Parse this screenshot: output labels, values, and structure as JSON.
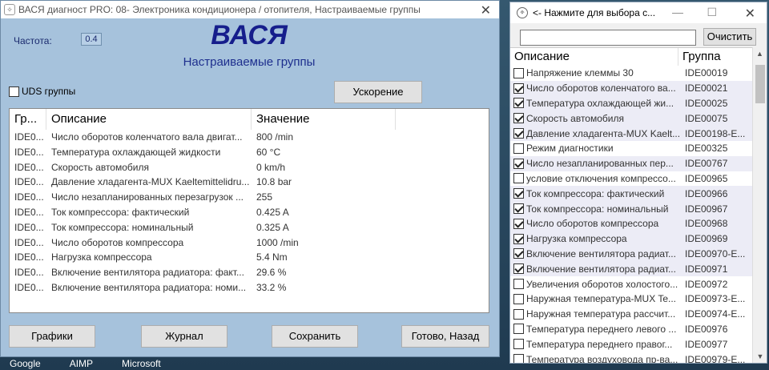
{
  "main_window": {
    "title": "ВАСЯ диагност PRO: 08- Электроника кондиционера / отопителя,  Настраиваемые группы",
    "freq_label": "Частота:",
    "freq_value": "0.4",
    "brand": "ВАСЯ",
    "subtitle": "Настраиваемые группы",
    "uds_label": "UDS группы",
    "accel_button": "Ускорение",
    "columns": [
      "Гр...",
      "Описание",
      "Значение"
    ],
    "rows": [
      {
        "id": "IDE0...",
        "desc": "Число оборотов коленчатого вала двигат...",
        "value": "800 /min"
      },
      {
        "id": "IDE0...",
        "desc": "Температура охлаждающей жидкости",
        "value": "60 °C"
      },
      {
        "id": "IDE0...",
        "desc": "Скорость автомобиля",
        "value": "0 km/h"
      },
      {
        "id": "IDE0...",
        "desc": "Давление хладагента-MUX Kaeltemittelidru...",
        "value": "10.8 bar"
      },
      {
        "id": "IDE0...",
        "desc": "Число незапланированных перезагрузок ...",
        "value": "255"
      },
      {
        "id": "IDE0...",
        "desc": "Ток компрессора: фактический",
        "value": "0.425 A"
      },
      {
        "id": "IDE0...",
        "desc": "Ток компрессора: номинальный",
        "value": "0.325 A"
      },
      {
        "id": "IDE0...",
        "desc": "Число оборотов компрессора",
        "value": "1000 /min"
      },
      {
        "id": "IDE0...",
        "desc": "Нагрузка компрессора",
        "value": "5.4 Nm"
      },
      {
        "id": "IDE0...",
        "desc": "Включение вентилятора радиатора: факт...",
        "value": "29.6 %"
      },
      {
        "id": "IDE0...",
        "desc": "Включение вентилятора радиатора: номи...",
        "value": "33.2 %"
      }
    ],
    "buttons": {
      "graphs": "Графики",
      "journal": "Журнал",
      "save": "Сохранить",
      "done": "Готово, Назад"
    }
  },
  "side_window": {
    "title": "<- Нажмите для выбора с...",
    "clear_button": "Очистить",
    "search_value": "",
    "columns": [
      "Описание",
      "Группа"
    ],
    "items": [
      {
        "desc": "Напряжение клеммы 30",
        "group": "IDE00019",
        "checked": false
      },
      {
        "desc": "Число оборотов коленчатого ва...",
        "group": "IDE00021",
        "checked": true
      },
      {
        "desc": "Температура охлаждающей жи...",
        "group": "IDE00025",
        "checked": true
      },
      {
        "desc": "Скорость автомобиля",
        "group": "IDE00075",
        "checked": true
      },
      {
        "desc": "Давление хладагента-MUX Kaelt...",
        "group": "IDE00198-E...",
        "checked": true
      },
      {
        "desc": "Режим диагностики",
        "group": "IDE00325",
        "checked": false
      },
      {
        "desc": "Число незапланированных пер...",
        "group": "IDE00767",
        "checked": true
      },
      {
        "desc": "условие отключения компрессо...",
        "group": "IDE00965",
        "checked": false
      },
      {
        "desc": "Ток компрессора: фактический",
        "group": "IDE00966",
        "checked": true
      },
      {
        "desc": "Ток компрессора: номинальный",
        "group": "IDE00967",
        "checked": true
      },
      {
        "desc": "Число оборотов компрессора",
        "group": "IDE00968",
        "checked": true
      },
      {
        "desc": "Нагрузка компрессора",
        "group": "IDE00969",
        "checked": true
      },
      {
        "desc": "Включение вентилятора радиат...",
        "group": "IDE00970-E...",
        "checked": true
      },
      {
        "desc": "Включение вентилятора радиат...",
        "group": "IDE00971",
        "checked": true
      },
      {
        "desc": "Увеличения оборотов холостого...",
        "group": "IDE00972",
        "checked": false
      },
      {
        "desc": "Наружная температура-MUX Te...",
        "group": "IDE00973-E...",
        "checked": false
      },
      {
        "desc": "Наружная температура рассчит...",
        "group": "IDE00974-E...",
        "checked": false
      },
      {
        "desc": "Температура переднего левого ...",
        "group": "IDE00976",
        "checked": false
      },
      {
        "desc": "Температура переднего правог...",
        "group": "IDE00977",
        "checked": false
      },
      {
        "desc": "Температура воздуховода пр-ва...",
        "group": "IDE00979-E...",
        "checked": false
      }
    ]
  },
  "taskbar": [
    "Google",
    "AIMP",
    "Microsoft"
  ]
}
